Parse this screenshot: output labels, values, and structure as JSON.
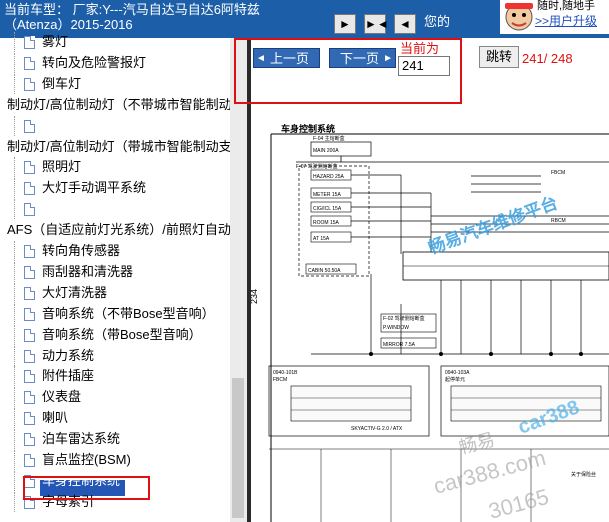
{
  "header": {
    "car_model_line1": "当前车型： 厂家:Y---汽马自达马自达6阿特兹",
    "car_model_line2": "（Atenza）2015-2016",
    "nav_buttons": [
      "►",
      "►◄",
      "◄"
    ],
    "hint": "您的",
    "ad_text": "随时,随地手",
    "ad_link": ">>用户升级"
  },
  "sidebar": {
    "items": [
      {
        "label": "雾灯",
        "level": 1
      },
      {
        "label": "转向及危险警报灯",
        "level": 1
      },
      {
        "label": "倒车灯",
        "level": 1
      },
      {
        "label": "制动灯/高位制动灯（不带城市智能制动",
        "level": 0
      },
      {
        "label": "",
        "level": 1
      },
      {
        "label": "制动灯/高位制动灯（带城市智能制动支",
        "level": 0
      },
      {
        "label": "照明灯",
        "level": 1
      },
      {
        "label": "大灯手动调平系统",
        "level": 1
      },
      {
        "label": "",
        "level": 1
      },
      {
        "label": "AFS（自适应前灯光系统）/前照灯自动",
        "level": 0
      },
      {
        "label": "转向角传感器",
        "level": 1
      },
      {
        "label": "雨刮器和清洗器",
        "level": 1
      },
      {
        "label": "大灯清洗器",
        "level": 1
      },
      {
        "label": "音响系统（不带Bose型音响）",
        "level": 1
      },
      {
        "label": "音响系统（带Bose型音响）",
        "level": 1
      },
      {
        "label": "动力系统",
        "level": 1
      },
      {
        "label": "附件插座",
        "level": 1
      },
      {
        "label": "仪表盘",
        "level": 1
      },
      {
        "label": "喇叭",
        "level": 1
      },
      {
        "label": "泊车雷达系统",
        "level": 1
      },
      {
        "label": "盲点监控(BSM)",
        "level": 1
      },
      {
        "label": "车身控制系统",
        "level": 1,
        "selected": true
      },
      {
        "label": "字母索引",
        "level": 1
      }
    ]
  },
  "pager": {
    "prev_label": "上一页",
    "next_label": "下一页",
    "current_label": "当前为",
    "current_page": "241",
    "jump_label": "跳转",
    "page_count": "241/ 248"
  },
  "diagram": {
    "title": "车身控制系统",
    "page_number": "234",
    "fuse_main": "MAIN 200A",
    "fuse_f04": "F-04 主熔断盒",
    "fuse_f07": "F-07 驾驶侧熔断盒",
    "fuse_hazard": "HAZARD 25A",
    "fuse_meter": "METER 15A",
    "fuse_cig": "CIG/ICL 15A",
    "fuse_room": "ROOM 15A",
    "fuse_at": "AT 15A",
    "fuse_cabin": "CABIN 50.50A",
    "fuse_f02": "F-02 驾驶侧熔断盒",
    "fuse_p_window": "P.WINDOW",
    "fuse_mirror": "MIRROR 7.5A",
    "module_fbcm": "FBCM",
    "module_rbcm": "RBCM",
    "connector_a": "0940-101B",
    "connector_b": "0940-103A",
    "connector_a_label": "FBCM",
    "connector_b_label": "起停单元",
    "footnote": "SKYACTIV-G 2.0 / ATX",
    "footer_right": "关于保险丝",
    "watermarks": [
      "畅易汽车维修平台",
      "car388",
      "畅易",
      "car388.com",
      "30165"
    ]
  },
  "colors": {
    "topbar": "#1c5fa8",
    "selected": "#2456b5",
    "highlight_border": "#e01010",
    "page_button": "#3169b5",
    "watermark": "#3aa0e0"
  }
}
